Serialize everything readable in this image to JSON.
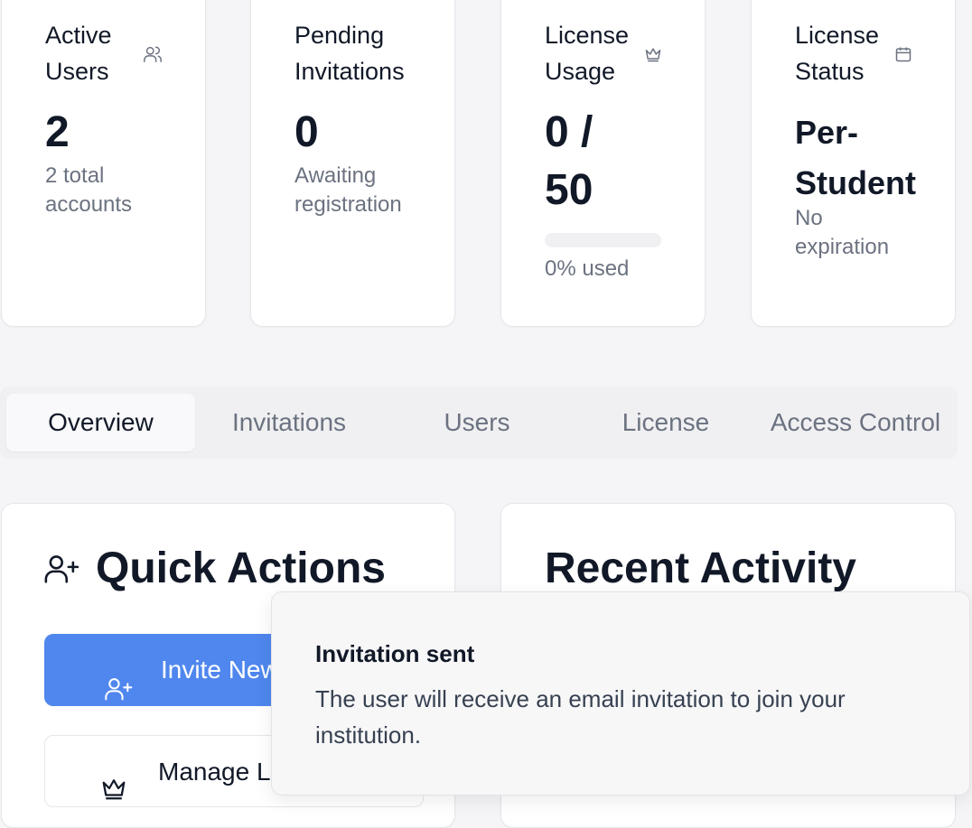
{
  "stats": {
    "active_users": {
      "title": "Active Users",
      "value": "2",
      "sub": "2 total accounts",
      "icon": "users-icon"
    },
    "pending_invitations": {
      "title": "Pending Invitations",
      "value": "0",
      "sub": "Awaiting registration"
    },
    "license_usage": {
      "title": "License Usage",
      "value": "0 / 50",
      "sub": "0% used",
      "percent_used": 0,
      "icon": "crown-icon"
    },
    "license_status": {
      "title": "License Status",
      "value": "Per-Student",
      "sub": "No expiration",
      "icon": "calendar-icon"
    }
  },
  "tabs": [
    {
      "label": "Overview",
      "active": true
    },
    {
      "label": "Invitations",
      "active": false
    },
    {
      "label": "Users",
      "active": false
    },
    {
      "label": "License",
      "active": false
    },
    {
      "label": "Access Control",
      "active": false
    }
  ],
  "quick_actions": {
    "title": "Quick Actions",
    "invite_label": "Invite New User",
    "manage_label": "Manage License"
  },
  "recent_activity": {
    "title": "Recent Activity"
  },
  "toast": {
    "title": "Invitation sent",
    "message": "The user will receive an email invitation to join your institution."
  },
  "colors": {
    "primary": "#4f87ee",
    "background": "#f5f5f7"
  }
}
